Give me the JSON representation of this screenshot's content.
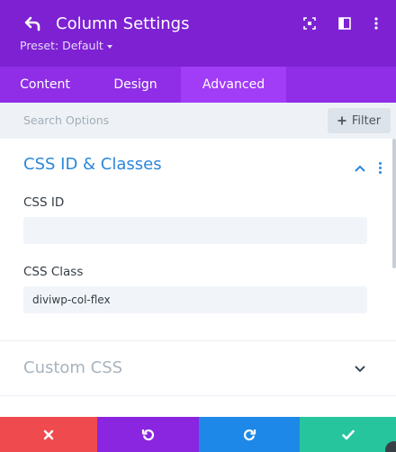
{
  "header": {
    "title": "Column Settings",
    "preset_label": "Preset: Default",
    "icons": [
      "back-arrow-icon",
      "fullscreen-icon",
      "sidebar-split-icon",
      "kebab-menu-icon"
    ],
    "background_color": "#7d21d3"
  },
  "tabs": [
    {
      "label": "Content",
      "active": false
    },
    {
      "label": "Design",
      "active": false
    },
    {
      "label": "Advanced",
      "active": true
    }
  ],
  "search": {
    "placeholder": "Search Options",
    "filter_label": "Filter"
  },
  "section_css": {
    "title": "CSS ID & Classes",
    "expanded": true,
    "fields": [
      {
        "label": "CSS ID",
        "value": ""
      },
      {
        "label": "CSS Class",
        "value": "diviwp-col-flex"
      }
    ]
  },
  "section_custom": {
    "title": "Custom CSS",
    "expanded": false
  },
  "footer": {
    "buttons": [
      {
        "name": "discard",
        "icon": "close-icon",
        "color": "#ef4a4d"
      },
      {
        "name": "undo",
        "icon": "undo-icon",
        "color": "#8a25e0"
      },
      {
        "name": "redo",
        "icon": "redo-icon",
        "color": "#1e88e8"
      },
      {
        "name": "save",
        "icon": "checkmark-icon",
        "color": "#26c59e"
      }
    ]
  },
  "accent_color": "#2b87da"
}
